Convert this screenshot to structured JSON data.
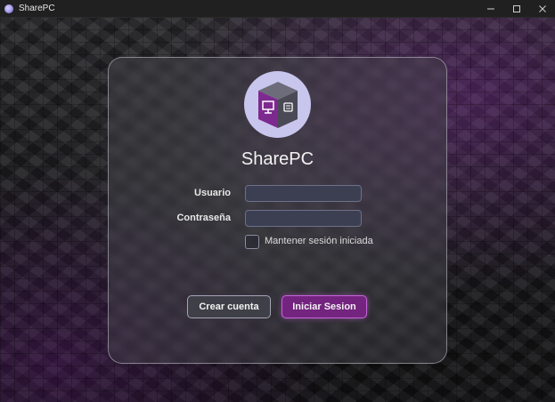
{
  "window": {
    "title": "SharePC",
    "icon": "app-icon",
    "controls": [
      "minimize-icon",
      "maximize-icon",
      "close-icon"
    ]
  },
  "login": {
    "app_name": "SharePC",
    "logo": "cube-pc-logo-icon",
    "username_label": "Usuario",
    "username_value": "",
    "password_label": "Contraseña",
    "password_value": "",
    "remember_label": "Mantener sesión iniciada",
    "remember_checked": false,
    "create_account_label": "Crear cuenta",
    "login_label": "Iniciar Sesion"
  },
  "colors": {
    "accent": "#73247f",
    "accent_border": "#c466d8",
    "logo_bg": "#c9c6ee",
    "input_bg": "#3c3f52"
  }
}
